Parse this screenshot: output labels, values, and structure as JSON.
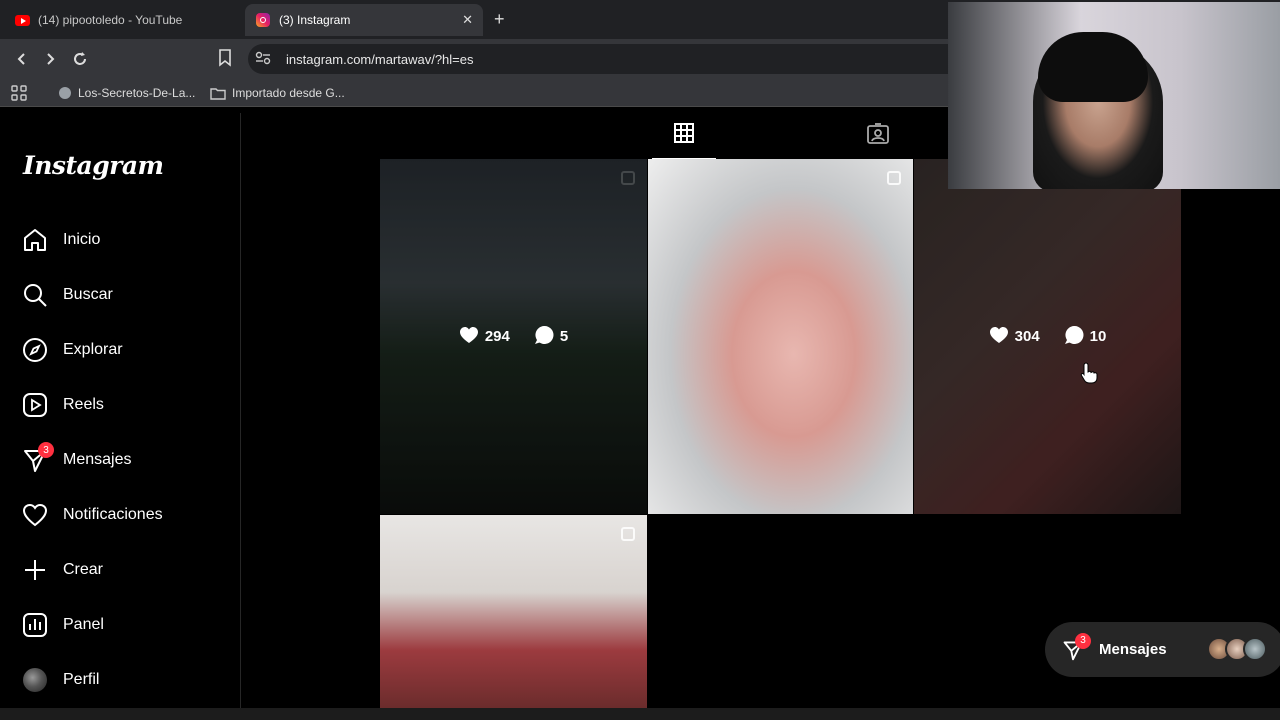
{
  "browser": {
    "tabs": [
      {
        "title": "(14) pipootoledo - YouTube",
        "icon": "youtube-icon"
      },
      {
        "title": "(3) Instagram",
        "icon": "instagram-icon",
        "active": true
      }
    ],
    "url": "instagram.com/martawav/?hl=es",
    "bookmarks": [
      {
        "label": "Los-Secretos-De-La..."
      },
      {
        "label": "Importado desde G..."
      }
    ]
  },
  "sidebar": {
    "logo": "Instagram",
    "items": [
      {
        "label": "Inicio",
        "icon": "home-icon"
      },
      {
        "label": "Buscar",
        "icon": "search-icon"
      },
      {
        "label": "Explorar",
        "icon": "compass-icon"
      },
      {
        "label": "Reels",
        "icon": "reels-icon"
      },
      {
        "label": "Mensajes",
        "icon": "messenger-icon",
        "badge": "3"
      },
      {
        "label": "Notificaciones",
        "icon": "heart-icon"
      },
      {
        "label": "Crear",
        "icon": "plus-icon"
      },
      {
        "label": "Panel",
        "icon": "dashboard-icon"
      },
      {
        "label": "Perfil",
        "icon": "avatar"
      }
    ]
  },
  "posts": [
    {
      "likes": "294",
      "comments": "5",
      "hover": true
    },
    {
      "hover": false
    },
    {
      "likes": "304",
      "comments": "10",
      "hover": true
    },
    {
      "hover": false
    }
  ],
  "messages_pill": {
    "label": "Mensajes",
    "badge": "3"
  },
  "colors": {
    "badge": "#ff3040",
    "background": "#000000",
    "chrome_bar": "#35363a"
  }
}
